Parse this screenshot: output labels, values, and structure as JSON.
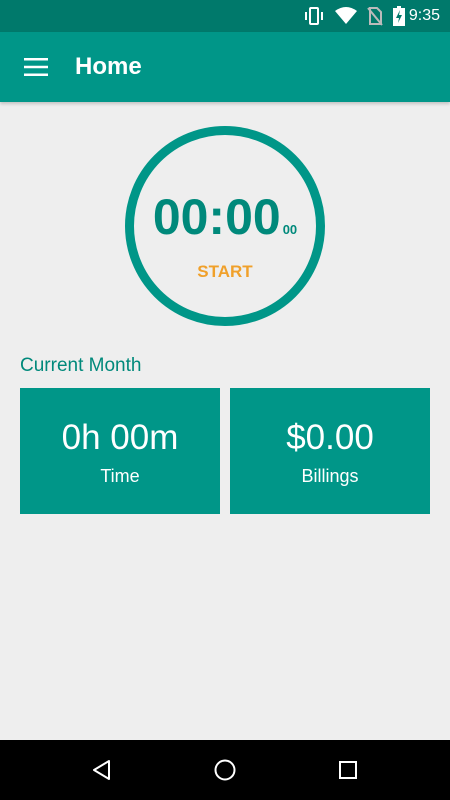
{
  "status_bar": {
    "time": "9:35",
    "icons": [
      "vibrate-icon",
      "wifi-icon",
      "no-sim-icon",
      "battery-charging-icon"
    ]
  },
  "app_bar": {
    "title": "Home",
    "menu_icon": "hamburger-menu-icon"
  },
  "timer": {
    "time": "00:00",
    "seconds": "00",
    "action_label": "START"
  },
  "summary": {
    "section_title": "Current Month",
    "cards": [
      {
        "value": "0h 00m",
        "label": "Time"
      },
      {
        "value": "$0.00",
        "label": "Billings"
      }
    ]
  },
  "nav_bar": {
    "buttons": [
      "back-icon",
      "home-icon",
      "recents-icon"
    ]
  },
  "colors": {
    "primary": "#009688",
    "primary_dark": "#00796b",
    "accent": "#f0a02a",
    "background": "#eeeeee"
  }
}
